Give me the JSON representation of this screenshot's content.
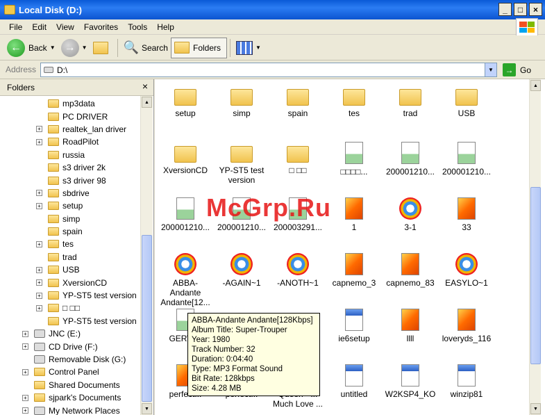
{
  "window": {
    "title": "Local Disk (D:)"
  },
  "menu": [
    "File",
    "Edit",
    "View",
    "Favorites",
    "Tools",
    "Help"
  ],
  "toolbar": {
    "back": "Back",
    "search": "Search",
    "folders": "Folders"
  },
  "address": {
    "label": "Address",
    "value": "D:\\",
    "go": "Go"
  },
  "folder_pane": {
    "title": "Folders",
    "close": "×",
    "tree": [
      {
        "label": "mp3data",
        "expander": "",
        "type": "folder"
      },
      {
        "label": "PC DRIVER",
        "expander": "",
        "type": "folder"
      },
      {
        "label": "realtek_lan driver",
        "expander": "+",
        "type": "folder"
      },
      {
        "label": "RoadPilot",
        "expander": "+",
        "type": "folder"
      },
      {
        "label": "russia",
        "expander": "",
        "type": "folder"
      },
      {
        "label": "s3 driver 2k",
        "expander": "",
        "type": "folder"
      },
      {
        "label": "s3 driver 98",
        "expander": "",
        "type": "folder"
      },
      {
        "label": "sbdrive",
        "expander": "+",
        "type": "folder"
      },
      {
        "label": "setup",
        "expander": "+",
        "type": "folder"
      },
      {
        "label": "simp",
        "expander": "",
        "type": "folder"
      },
      {
        "label": "spain",
        "expander": "",
        "type": "folder"
      },
      {
        "label": "tes",
        "expander": "+",
        "type": "folder"
      },
      {
        "label": "trad",
        "expander": "",
        "type": "folder"
      },
      {
        "label": "USB",
        "expander": "+",
        "type": "folder"
      },
      {
        "label": "XversionCD",
        "expander": "+",
        "type": "folder"
      },
      {
        "label": "YP-ST5 test version",
        "expander": "+",
        "type": "folder"
      },
      {
        "label": "□ □□",
        "expander": "+",
        "type": "folder"
      },
      {
        "label": "YP-ST5 test version",
        "expander": "",
        "type": "folder"
      },
      {
        "label": "JNC (E:)",
        "expander": "+",
        "type": "drive"
      },
      {
        "label": "CD Drive (F:)",
        "expander": "+",
        "type": "drive"
      },
      {
        "label": "Removable Disk (G:)",
        "expander": "",
        "type": "drive"
      },
      {
        "label": "Control Panel",
        "expander": "+",
        "type": "folder"
      },
      {
        "label": "Shared Documents",
        "expander": "",
        "type": "folder"
      },
      {
        "label": "sjpark's Documents",
        "expander": "+",
        "type": "folder"
      },
      {
        "label": "My Network Places",
        "expander": "+",
        "type": "drive"
      }
    ]
  },
  "files": [
    {
      "label": "setup",
      "type": "folder"
    },
    {
      "label": "simp",
      "type": "folder"
    },
    {
      "label": "spain",
      "type": "folder"
    },
    {
      "label": "tes",
      "type": "folder"
    },
    {
      "label": "trad",
      "type": "folder"
    },
    {
      "label": "USB",
      "type": "folder"
    },
    {
      "label": "XversionCD",
      "type": "folder"
    },
    {
      "label": "YP-ST5 test version",
      "type": "folder"
    },
    {
      "label": "□ □□",
      "type": "folder"
    },
    {
      "label": "□□□□...",
      "type": "doc"
    },
    {
      "label": "200001210...",
      "type": "doc"
    },
    {
      "label": "200001210...",
      "type": "doc"
    },
    {
      "label": "200001210...",
      "type": "doc"
    },
    {
      "label": "200001210...",
      "type": "doc"
    },
    {
      "label": "200003291...",
      "type": "doc"
    },
    {
      "label": "1",
      "type": "image"
    },
    {
      "label": "3-1",
      "type": "media"
    },
    {
      "label": "33",
      "type": "image"
    },
    {
      "label": "ABBA-Andante Andante[12...",
      "type": "media"
    },
    {
      "label": "-AGAIN~1",
      "type": "media"
    },
    {
      "label": "-ANOTH~1",
      "type": "media"
    },
    {
      "label": "capnemo_3",
      "type": "image"
    },
    {
      "label": "capnemo_83",
      "type": "image"
    },
    {
      "label": "EASYLO~1",
      "type": "media"
    },
    {
      "label": "GERWM",
      "type": "doc"
    },
    {
      "label": "",
      "type": "none"
    },
    {
      "label": "",
      "type": "none"
    },
    {
      "label": "ie6setup",
      "type": "app"
    },
    {
      "label": "llll",
      "type": "image"
    },
    {
      "label": "loveryds_116",
      "type": "image"
    },
    {
      "label": "perfect...",
      "type": "image"
    },
    {
      "label": "perfect...",
      "type": "image"
    },
    {
      "label": "Queen - ... Much Love ...",
      "type": "media"
    },
    {
      "label": "untitled",
      "type": "app"
    },
    {
      "label": "W2KSP4_KO",
      "type": "app"
    },
    {
      "label": "winzip81",
      "type": "app"
    }
  ],
  "tooltip": {
    "lines": [
      "ABBA-Andante Andante[128Kbps]",
      "Album Title: Super-Trouper",
      "Year: 1980",
      "Track Number: 32",
      "Duration: 0:04:40",
      "Type: MP3 Format Sound",
      "Bit Rate: 128kbps",
      "Size: 4.28 MB"
    ]
  },
  "watermark": "McGrp.Ru",
  "colors": {
    "titlebar": "#0a5ad7",
    "chrome": "#ece9d8",
    "tooltip": "#ffffe1",
    "watermark": "#e61414"
  }
}
